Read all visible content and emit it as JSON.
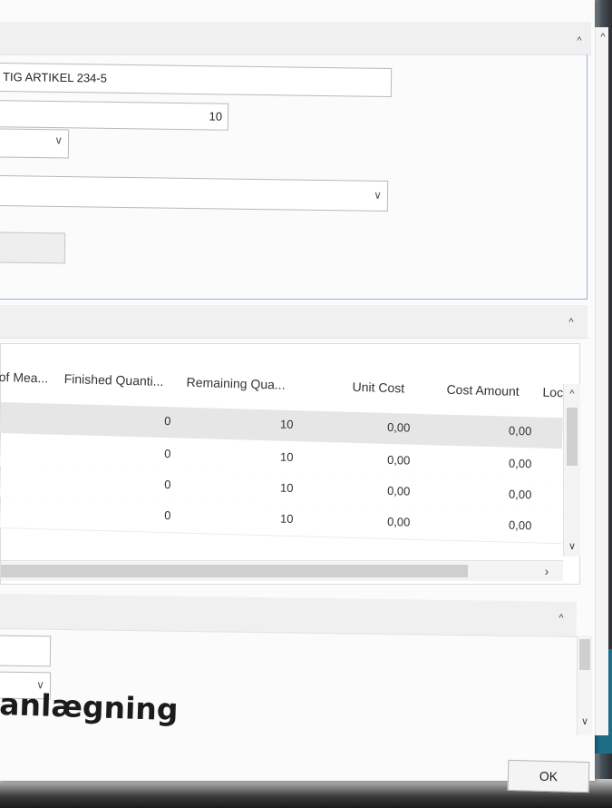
{
  "general": {
    "description_value": "TIG ARTIKEL 234-5",
    "quantity_value": "10"
  },
  "lines": {
    "columns": [
      "of Mea...",
      "Finished Quanti...",
      "Remaining Qua...",
      "Unit Cost",
      "Cost Amount",
      "Loc"
    ],
    "rows": [
      {
        "finished": "0",
        "remaining": "10",
        "unit_cost": "0,00",
        "cost_amount": "0,00"
      },
      {
        "finished": "0",
        "remaining": "10",
        "unit_cost": "0,00",
        "cost_amount": "0,00"
      },
      {
        "finished": "0",
        "remaining": "10",
        "unit_cost": "0,00",
        "cost_amount": "0,00"
      },
      {
        "finished": "0",
        "remaining": "10",
        "unit_cost": "0,00",
        "cost_amount": "0,00"
      }
    ]
  },
  "overlay": {
    "heading": "anlægning"
  },
  "footer": {
    "ok_label": "OK"
  },
  "icons": {
    "collapse": "chevron-up-icon",
    "dropdown": "chevron-down-icon",
    "scroll_right": "chevron-right-icon"
  },
  "colors": {
    "focus_border": "#8fb3e8",
    "selected_row": "#e6e6e6",
    "teal_backdrop": "#1d6d86"
  }
}
